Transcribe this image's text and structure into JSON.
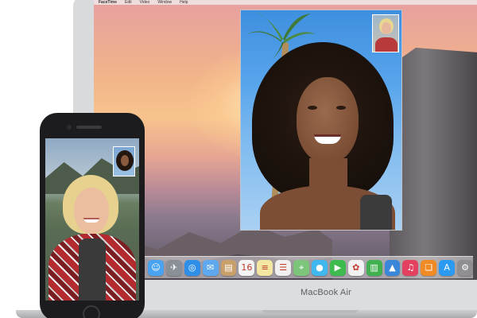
{
  "menubar": {
    "items": [
      "FaceTime",
      "Edit",
      "Video",
      "Window",
      "Help"
    ]
  },
  "device_labels": {
    "laptop_name": "MacBook Air"
  },
  "dock": {
    "apps": [
      {
        "name": "Finder",
        "icon": "finder-icon",
        "glyph": "☺",
        "color": "#4aa3f0"
      },
      {
        "name": "Launchpad",
        "icon": "launchpad-icon",
        "glyph": "✈",
        "color": "#8a8f98"
      },
      {
        "name": "Safari",
        "icon": "safari-icon",
        "glyph": "◎",
        "color": "#2f8fe8"
      },
      {
        "name": "Mail",
        "icon": "mail-icon",
        "glyph": "✉",
        "color": "#5da8ef"
      },
      {
        "name": "Contacts",
        "icon": "contacts-icon",
        "glyph": "▤",
        "color": "#c9a06a"
      },
      {
        "name": "Calendar",
        "icon": "calendar-icon",
        "glyph": "16",
        "color": "#f4f4f4"
      },
      {
        "name": "Notes",
        "icon": "notes-icon",
        "glyph": "≡",
        "color": "#f3e7a2"
      },
      {
        "name": "Reminders",
        "icon": "reminders-icon",
        "glyph": "☰",
        "color": "#f0f0f0"
      },
      {
        "name": "Maps",
        "icon": "maps-icon",
        "glyph": "⌖",
        "color": "#7cc57a"
      },
      {
        "name": "Messages",
        "icon": "messages-icon",
        "glyph": "●",
        "color": "#3fb8f0"
      },
      {
        "name": "FaceTime",
        "icon": "facetime-icon",
        "glyph": "▶",
        "color": "#3dbb4f"
      },
      {
        "name": "Photos",
        "icon": "photos-icon",
        "glyph": "✿",
        "color": "#f2f2f2"
      },
      {
        "name": "Numbers",
        "icon": "numbers-icon",
        "glyph": "▥",
        "color": "#41b14f"
      },
      {
        "name": "Keynote",
        "icon": "keynote-icon",
        "glyph": "▲",
        "color": "#3a86d8"
      },
      {
        "name": "iTunes",
        "icon": "itunes-icon",
        "glyph": "♫",
        "color": "#e4405f"
      },
      {
        "name": "iBooks",
        "icon": "ibooks-icon",
        "glyph": "❑",
        "color": "#f08a24"
      },
      {
        "name": "App Store",
        "icon": "app-store-icon",
        "glyph": "A",
        "color": "#2a9af2"
      },
      {
        "name": "System Preferences",
        "icon": "system-preferences-icon",
        "glyph": "⚙",
        "color": "#8e8e93"
      }
    ]
  }
}
